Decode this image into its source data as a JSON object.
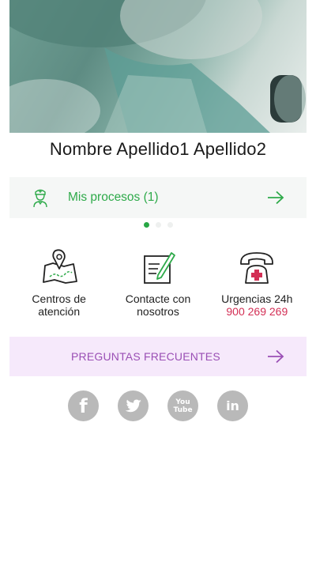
{
  "user": {
    "name": "Nombre Apellido1 Apellido2"
  },
  "processes": {
    "label": "Mis procesos (1)",
    "icon": "nurse-icon",
    "arrow_icon": "arrow-right-icon"
  },
  "carousel": {
    "pages": 3,
    "active_index": 0
  },
  "quick_actions": [
    {
      "icon": "map-location-icon",
      "title_line1": "Centros de",
      "title_line2": "atención"
    },
    {
      "icon": "edit-note-icon",
      "title_line1": "Contacte con",
      "title_line2": "nosotros"
    },
    {
      "icon": "emergency-phone-icon",
      "title_line1": "Urgencias 24h",
      "phone": "900 269 269"
    }
  ],
  "faq": {
    "label": "PREGUNTAS FRECUENTES",
    "arrow_icon": "arrow-right-icon"
  },
  "social": [
    {
      "name": "facebook-icon",
      "glyph": "f"
    },
    {
      "name": "twitter-icon",
      "glyph": ""
    },
    {
      "name": "youtube-icon",
      "glyph_top": "You",
      "glyph_bottom": "Tube"
    },
    {
      "name": "linkedin-icon",
      "glyph": "in"
    }
  ],
  "colors": {
    "green": "#2eaa4a",
    "purple": "#9a4fb5",
    "phone_red": "#d32f55",
    "social_gray": "#b9b9b9"
  }
}
